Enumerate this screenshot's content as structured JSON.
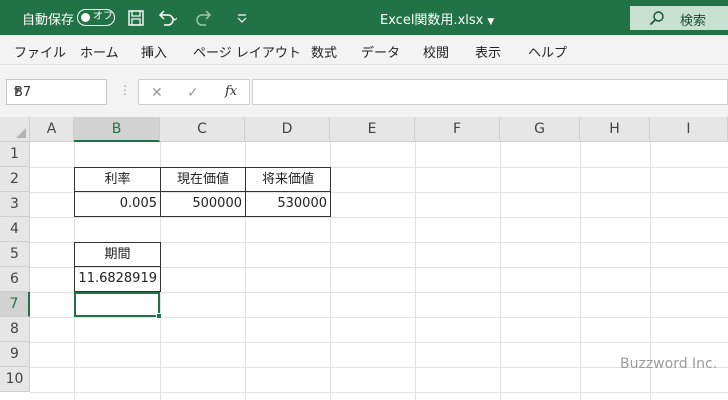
{
  "titlebar": {
    "autosave_label": "自動保存",
    "autosave_state": "オフ",
    "document_title": "Excel関数用.xlsx",
    "search_label": "検索",
    "icons": [
      "save-icon",
      "undo-icon",
      "redo-icon",
      "customize-qat-icon",
      "search-icon"
    ]
  },
  "ribbon": {
    "tabs": [
      "ファイル",
      "ホーム",
      "挿入",
      "ページ レイアウト",
      "数式",
      "データ",
      "校閲",
      "表示",
      "ヘルプ"
    ]
  },
  "formula_bar": {
    "name_box": "B7",
    "formula": "",
    "fx_label": "fx"
  },
  "sheet": {
    "columns": [
      "A",
      "B",
      "C",
      "D",
      "E",
      "F",
      "G",
      "H",
      "I"
    ],
    "rows": [
      "1",
      "2",
      "3",
      "4",
      "5",
      "6",
      "7",
      "8",
      "9",
      "10"
    ],
    "selected_column": "B",
    "selected_row": "7",
    "cells": {
      "B2": "利率",
      "C2": "現在価値",
      "D2": "将来価値",
      "B3": "0.005",
      "C3": "500000",
      "D3": "530000",
      "B5": "期間",
      "B6": "11.6828919"
    },
    "watermark": "Buzzword Inc."
  },
  "colors": {
    "excel_green": "#217346",
    "header_gray": "#e6e6e6",
    "gridline": "#e2e2e2"
  }
}
